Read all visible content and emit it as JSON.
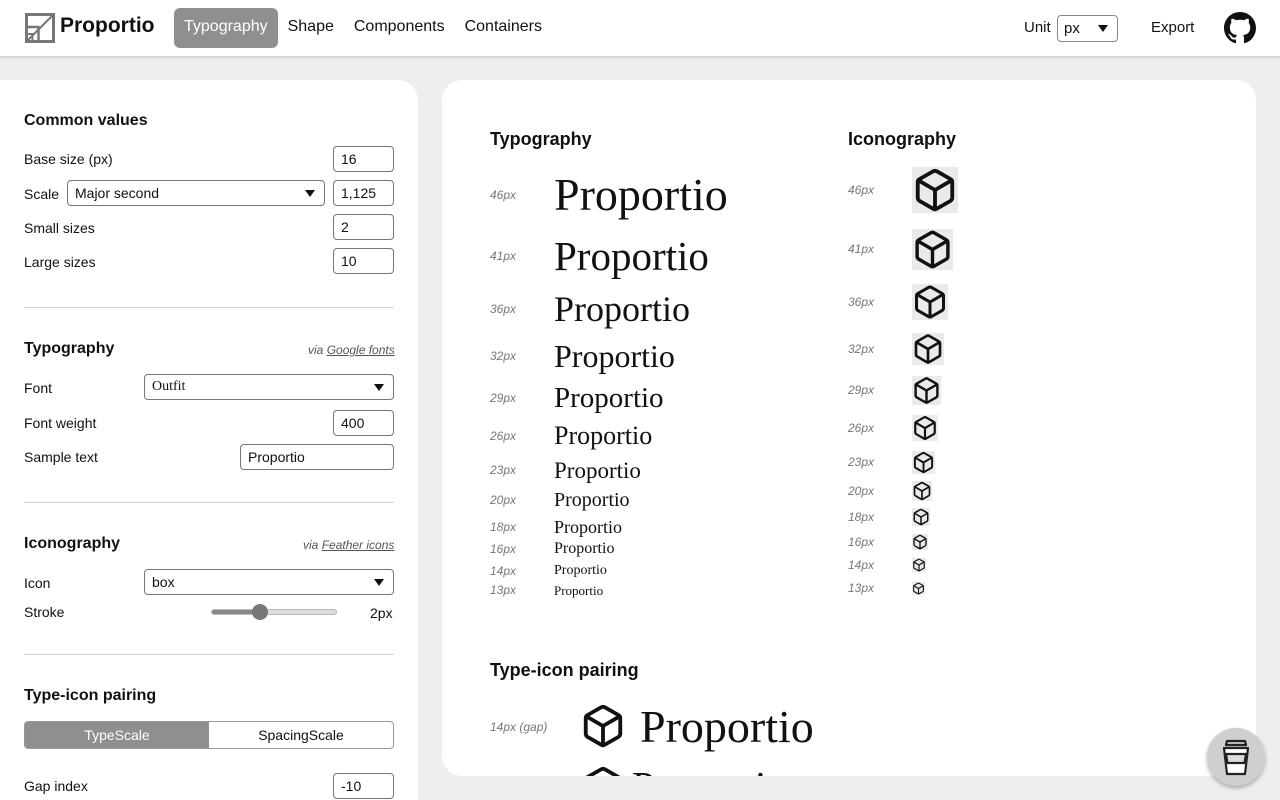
{
  "app": {
    "name": "Proportio"
  },
  "nav": {
    "tabs": [
      "Typography",
      "Shape",
      "Components",
      "Containers"
    ]
  },
  "header": {
    "unit_label": "Unit",
    "unit_value": "px",
    "export_label": "Export"
  },
  "common": {
    "title": "Common values",
    "base_size_label": "Base size (px)",
    "base_size_value": "16",
    "scale_label": "Scale",
    "scale_select": "Major second",
    "scale_value": "1,125",
    "small_label": "Small sizes",
    "small_value": "2",
    "large_label": "Large sizes",
    "large_value": "10"
  },
  "typography_settings": {
    "title": "Typography",
    "via_prefix": "via",
    "via_link": "Google fonts",
    "font_label": "Font",
    "font_value": "Outfit",
    "weight_label": "Font weight",
    "weight_value": "400",
    "sample_label": "Sample text",
    "sample_value": "Proportio"
  },
  "iconography_settings": {
    "title": "Iconography",
    "via_prefix": "via",
    "via_link": "Feather icons",
    "icon_label": "Icon",
    "icon_value": "box",
    "stroke_label": "Stroke",
    "stroke_value": "2px",
    "stroke_fraction": 0.39
  },
  "pairing_settings": {
    "title": "Type-icon pairing",
    "options": [
      "TypeScale",
      "SpacingScale"
    ],
    "gap_label": "Gap index",
    "gap_value": "-10"
  },
  "preview": {
    "typography_title": "Typography",
    "iconography_title": "Iconography",
    "pairing_title": "Type-icon pairing",
    "sample_text": "Proportio",
    "sizes": [
      "46px",
      "41px",
      "36px",
      "32px",
      "29px",
      "26px",
      "23px",
      "20px",
      "18px",
      "16px",
      "14px",
      "13px"
    ],
    "pairing_label": "14px (gap)"
  },
  "icons": {
    "logo": "proportio-logo-icon",
    "github": "github-icon",
    "box": "box-icon",
    "coffee": "coffee-cup-icon"
  }
}
